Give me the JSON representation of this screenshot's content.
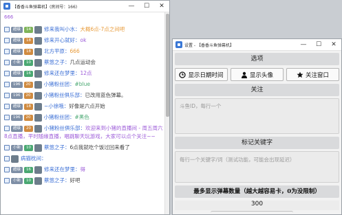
{
  "chat_window": {
    "title": "【香香斗鱼弹幕机】(房间号：166)",
    "first_line": "666",
    "messages": [
      {
        "badge": "超级",
        "lv": "14",
        "lv_color": "#7fb45a",
        "name": "修来我叫小水：",
        "text": "大概6点-7点之间吧",
        "text_color": "#e89b3a"
      },
      {
        "badge": "超级",
        "lv": "18",
        "lv_color": "#d08b40",
        "name": "修来开心就好：",
        "text": "ok",
        "text_color": "#9c5bd8"
      },
      {
        "badge": "超级",
        "lv": "18",
        "lv_color": "#d08b40",
        "name": "北方平原：",
        "text": "666",
        "text_color": "#e89b3a"
      },
      {
        "badge": "小新",
        "lv": "10",
        "lv_color": "#4aa872",
        "name": "蔡悠之子：",
        "text": "几点运动会",
        "text_color": "#444"
      },
      {
        "badge": "超级",
        "lv": "16",
        "lv_color": "#4aa872",
        "name": "修来还在梦里：",
        "text": "12点",
        "text_color": "#9c5bd8"
      },
      {
        "badge": "196",
        "lv": "20",
        "lv_color": "#d08b40",
        "name": "小猪粉丝团：",
        "text": "#blue",
        "text_color": "#4aa872"
      },
      {
        "badge": "196",
        "lv": "20",
        "lv_color": "#d08b40",
        "name": "小猪粉丝俱乐部：",
        "text": "已改用蓝色弹幕。",
        "text_color": "#444"
      },
      {
        "badge": "超级",
        "lv": "18",
        "lv_color": "#d08b40",
        "name": "~小徐哦：",
        "text": "好像是六点开始",
        "text_color": "#444"
      },
      {
        "badge": "196",
        "lv": "20",
        "lv_color": "#d08b40",
        "name": "小猪粉丝团：",
        "text": "#黑色",
        "text_color": "#4aa872"
      },
      {
        "badge": "超级",
        "lv": "20",
        "lv_color": "#d08b40",
        "name": "小猪粉丝俱乐部：",
        "text": "欢迎来到小猪的直播间 - 周五周六8点直播，平时随缘直播，唱跳聊天玩游戏，大家可以点个关注~~",
        "text_color": "#9c5bd8",
        "wrap": true
      },
      {
        "badge": "小新",
        "lv": "10",
        "lv_color": "#4aa872",
        "name": "蔡悠之子：",
        "text": "6点我就吃个饭过回来看了",
        "text_color": "#444"
      },
      {
        "badge": "",
        "lv": "",
        "lv_color": "#4aa872",
        "name": "病猫枕间：",
        "text": "",
        "text_color": "#444"
      },
      {
        "badge": "超级",
        "lv": "16",
        "lv_color": "#4aa872",
        "name": "修来还在梦里：",
        "text": "得",
        "text_color": "#9c5bd8"
      },
      {
        "badge": "小新",
        "lv": "10",
        "lv_color": "#4aa872",
        "name": "蔡悠之子：",
        "text": "好吧",
        "text_color": "#444"
      }
    ]
  },
  "settings_window": {
    "title": "设置 - 【香香斗鱼弹幕机】",
    "options_header": "选项",
    "btn_show_date": "显示日期时间",
    "btn_show_avatar": "显示头像",
    "btn_close_window": "关注窗口",
    "follow_header": "关注",
    "follow_placeholder": "斗鱼ID，每行一个",
    "keyword_header": "标记关键字",
    "keyword_placeholder": "每行一个关键字/词（测试功能，可能会出现延迟）",
    "max_header": "最多显示弹幕数量（越大越容易卡，0为没限制）",
    "max_value": "300"
  },
  "colors": {
    "accent": "#3b6fd6",
    "purple": "#9c5bd8",
    "orange": "#e89b3a"
  }
}
